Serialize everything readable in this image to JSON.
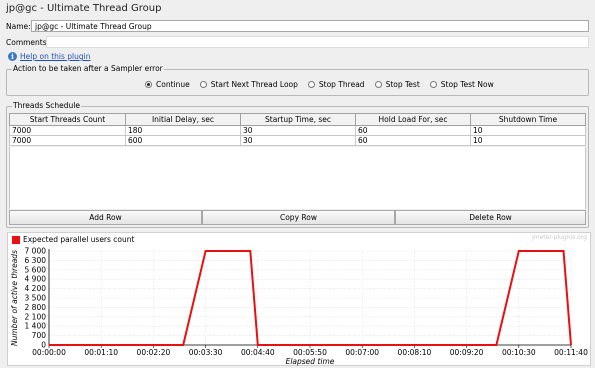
{
  "window": {
    "title": "jp@gc - Ultimate Thread Group"
  },
  "form": {
    "name_label": "Name:",
    "name_value": "jp@gc - Ultimate Thread Group",
    "comments_label": "Comments:",
    "comments_value": "",
    "help_link": "Help on this plugin",
    "help_icon": "info-icon"
  },
  "sampler_error": {
    "title": "Action to be taken after a Sampler error",
    "options": [
      "Continue",
      "Start Next Thread Loop",
      "Stop Thread",
      "Stop Test",
      "Stop Test Now"
    ],
    "selected": "Continue"
  },
  "schedule": {
    "title": "Threads Schedule",
    "columns": [
      "Start Threads Count",
      "Initial Delay, sec",
      "Startup Time, sec",
      "Hold Load For, sec",
      "Shutdown Time"
    ],
    "rows": [
      [
        "7000",
        "180",
        "30",
        "60",
        "10"
      ],
      [
        "7000",
        "600",
        "30",
        "60",
        "10"
      ]
    ],
    "buttons": {
      "add": "Add Row",
      "copy": "Copy Row",
      "delete": "Delete Row"
    }
  },
  "chart_data": {
    "type": "line",
    "legend": "Expected parallel users count",
    "legend_position": "top-left",
    "color": "#e81010",
    "watermark": "jmeter-plugins.org",
    "xlabel": "Elapsed time",
    "ylabel": "Number of active threads",
    "xlim": [
      0,
      700
    ],
    "ylim": [
      0,
      7000
    ],
    "x_ticks": [
      "00:00:00",
      "00:01:10",
      "00:02:20",
      "00:03:30",
      "00:04:40",
      "00:05:50",
      "00:07:00",
      "00:08:10",
      "00:09:20",
      "00:10:30",
      "00:11:40"
    ],
    "y_ticks": [
      "0",
      "700",
      "1 400",
      "2 100",
      "2 800",
      "3 500",
      "4 200",
      "4 900",
      "5 600",
      "6 300",
      "7 000"
    ],
    "grid": true,
    "series": [
      {
        "name": "Expected parallel users count",
        "x": [
          0,
          180,
          210,
          270,
          280,
          600,
          630,
          690,
          700
        ],
        "values": [
          0,
          0,
          7000,
          7000,
          0,
          0,
          7000,
          7000,
          0
        ]
      }
    ]
  }
}
